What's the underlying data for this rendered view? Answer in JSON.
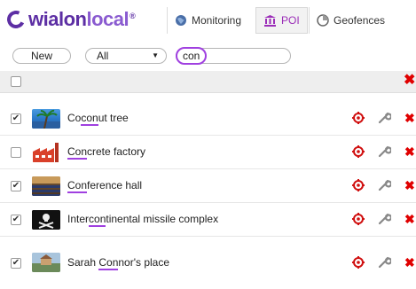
{
  "brand": {
    "logo_part1": "wialon",
    "logo_part2": "local",
    "logo_sup": "®"
  },
  "tabs": [
    {
      "label": "Monitoring",
      "icon": "globe-icon",
      "active": false
    },
    {
      "label": "POI",
      "icon": "museum-icon",
      "active": true
    },
    {
      "label": "Geofences",
      "icon": "geofence-icon",
      "active": false
    }
  ],
  "filter": {
    "new_label": "New",
    "type_selected": "All",
    "search_value": "con"
  },
  "rows": [
    {
      "name_pre": "Co",
      "name_mark": "con",
      "name_post": "ut tree",
      "checked": true,
      "thumb": "coconut"
    },
    {
      "name_pre": "",
      "name_mark": "Con",
      "name_post": "crete factory",
      "checked": false,
      "thumb": "factory"
    },
    {
      "name_pre": "",
      "name_mark": "Con",
      "name_post": "ference hall",
      "checked": true,
      "thumb": "hall"
    },
    {
      "name_pre": "Inter",
      "name_mark": "con",
      "name_post": "tinental missile complex",
      "checked": true,
      "thumb": "pirate"
    },
    {
      "name_pre": "Sarah ",
      "name_mark": "Con",
      "name_post": "nor's place",
      "checked": true,
      "thumb": "sarah"
    }
  ],
  "colors": {
    "accent": "#a040e0",
    "brand": "#5d2fa4",
    "delete": "#e00000",
    "target": "#d01010"
  }
}
